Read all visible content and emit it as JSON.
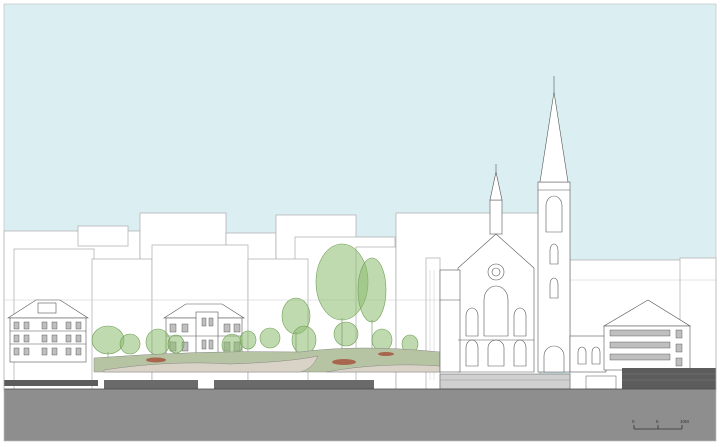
{
  "colors": {
    "sky": "#dbeff3",
    "ground": "#8e8e8e",
    "building_fill": "#ffffff",
    "building_stroke": "#9a9a9a",
    "line_dark": "#555555",
    "tree_green": "#8dbb6f",
    "tree_green_dark": "#6f9e55",
    "lawn": "#b7c4a3",
    "path": "#d9d3c7",
    "flowerbed": "#a9664e",
    "wall_stone": "#5c5c5c"
  },
  "icons": {
    "scale_bar": "scale-bar-icon"
  },
  "scale": {
    "tick_0": "0",
    "tick_5": "5",
    "tick_10": "10M"
  }
}
